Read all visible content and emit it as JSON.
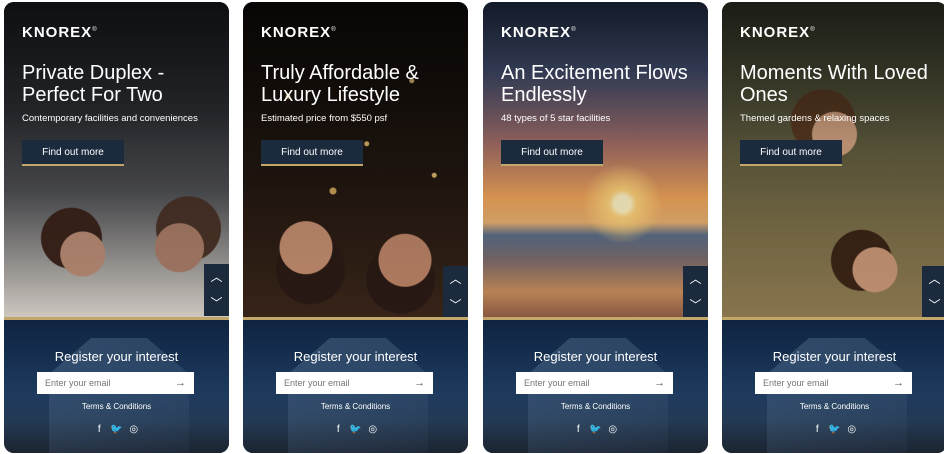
{
  "brand": {
    "logo": "KNOREX",
    "trademark": "®"
  },
  "cards": [
    {
      "headline": "Private Duplex - Perfect For Two",
      "subtitle": "Contemporary facilities and conveniences",
      "cta_label": "Find out more",
      "scene": "couple-lying-on-blanket"
    },
    {
      "headline": "Truly Affordable & Luxury Lifestyle",
      "subtitle": "Estimated price from $550 psf",
      "cta_label": "Find out more",
      "scene": "party-confetti"
    },
    {
      "headline": "An Excitement Flows Endlessly",
      "subtitle": "48 types of 5 star facilities",
      "cta_label": "Find out more",
      "scene": "infinity-pool-sunset"
    },
    {
      "headline": "Moments With Loved Ones",
      "subtitle": "Themed gardens & relaxing spaces",
      "cta_label": "Find out more",
      "scene": "mother-daughter-on-grass"
    }
  ],
  "nav": {
    "up_icon": "chevron-up-icon",
    "down_icon": "chevron-down-icon",
    "up_glyph": "︿",
    "down_glyph": "﹀"
  },
  "register": {
    "title": "Register your interest",
    "email_placeholder": "Enter your email",
    "submit_glyph": "→",
    "terms": "Terms & Conditions"
  },
  "social": {
    "facebook": "f",
    "twitter": "🐦",
    "instagram": "◎"
  },
  "colors": {
    "navy": "#1b2a3d",
    "gold": "#c2a66a",
    "panel": "#0f2441"
  }
}
